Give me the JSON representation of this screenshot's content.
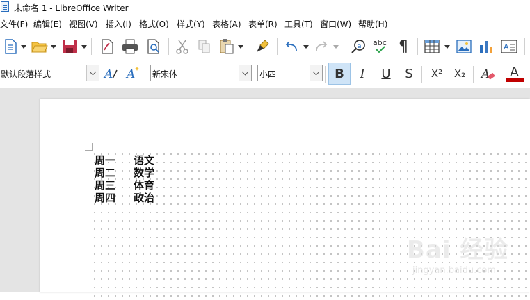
{
  "window": {
    "title": "未命名 1 - LibreOffice Writer"
  },
  "menubar": {
    "items": [
      {
        "label": "文件(F)"
      },
      {
        "label": "编辑(E)"
      },
      {
        "label": "视图(V)"
      },
      {
        "label": "插入(I)"
      },
      {
        "label": "格式(O)"
      },
      {
        "label": "样式(Y)"
      },
      {
        "label": "表格(A)"
      },
      {
        "label": "表单(R)"
      },
      {
        "label": "工具(T)"
      },
      {
        "label": "窗口(W)"
      },
      {
        "label": "帮助(H)"
      }
    ]
  },
  "toolbar2": {
    "paragraph_style": "默认段落样式",
    "font_name": "新宋体",
    "font_size": "小四",
    "bold_label": "B",
    "italic_label": "I",
    "underline_label": "U",
    "strike_label": "S",
    "superscript_label": "X²",
    "subscript_label": "X₂"
  },
  "document": {
    "lines": [
      {
        "day": "周一",
        "subject": "语文"
      },
      {
        "day": "周二",
        "subject": "数学"
      },
      {
        "day": "周三",
        "subject": "体育"
      },
      {
        "day": "周四",
        "subject": "政治"
      }
    ]
  },
  "watermark": {
    "main": "Bai 经验",
    "sub": "jingyan.baidu.com"
  },
  "colors": {
    "accent": "#2a6ebd",
    "font_color_bar": "#c00000",
    "bold_active_bg": "#cfe4f7"
  }
}
